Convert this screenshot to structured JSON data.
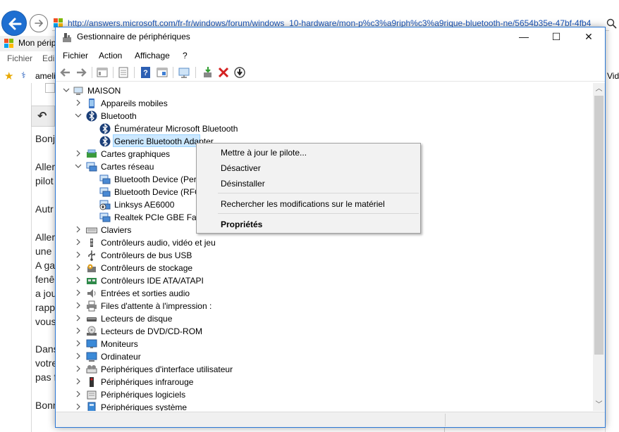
{
  "browser": {
    "url": "http://answers.microsoft.com/fr-fr/windows/forum/windows_10-hardware/mon-p%c3%a9riph%c3%a9rique-bluetooth-ne/5654b35e-47bf-4fb4",
    "tab_title": "Mon périp",
    "menu": [
      "Fichier",
      "Edi"
    ],
    "fav_item": "ameli",
    "fav_right": "Vid",
    "content_lines": [
      "Bonj",
      "Aller",
      "pilot",
      "Autr",
      "Aller",
      "une",
      "A ga",
      "fenê",
      "a jou",
      "rapp",
      "vous",
      "Dans",
      "votre",
      "pas f",
      "Bonn"
    ]
  },
  "window": {
    "title": "Gestionnaire de périphériques",
    "controls": {
      "minimize": "—",
      "maximize": "☐",
      "close": "✕"
    },
    "menu": [
      "Fichier",
      "Action",
      "Affichage",
      "?"
    ]
  },
  "tree": {
    "root": "MAISON",
    "items": [
      {
        "label": "Appareils mobiles",
        "icon": "mobile-device-icon",
        "level": 1,
        "expanded": false
      },
      {
        "label": "Bluetooth",
        "icon": "bluetooth-icon",
        "level": 1,
        "expanded": true
      },
      {
        "label": "Énumérateur Microsoft Bluetooth",
        "icon": "bluetooth-icon",
        "level": 2
      },
      {
        "label": "Generic Bluetooth Adapter",
        "icon": "bluetooth-icon",
        "level": 2,
        "selected": true
      },
      {
        "label": "Cartes graphiques",
        "icon": "display-adapter-icon",
        "level": 1,
        "expanded": false
      },
      {
        "label": "Cartes réseau",
        "icon": "network-adapter-icon",
        "level": 1,
        "expanded": true
      },
      {
        "label": "Bluetooth Device (Per",
        "icon": "network-adapter-icon",
        "level": 2
      },
      {
        "label": "Bluetooth Device (RFC",
        "icon": "network-adapter-icon",
        "level": 2
      },
      {
        "label": "Linksys AE6000",
        "icon": "network-adapter-warning-icon",
        "level": 2
      },
      {
        "label": "Realtek PCIe GBE Fam",
        "icon": "network-adapter-icon",
        "level": 2
      },
      {
        "label": "Claviers",
        "icon": "keyboard-icon",
        "level": 1,
        "expanded": false
      },
      {
        "label": "Contrôleurs audio, vidéo et jeu",
        "icon": "audio-icon",
        "level": 1,
        "expanded": false
      },
      {
        "label": "Contrôleurs de bus USB",
        "icon": "usb-icon",
        "level": 1,
        "expanded": false
      },
      {
        "label": "Contrôleurs de stockage",
        "icon": "storage-controller-icon",
        "level": 1,
        "expanded": false
      },
      {
        "label": "Contrôleurs IDE ATA/ATAPI",
        "icon": "ide-controller-icon",
        "level": 1,
        "expanded": false
      },
      {
        "label": "Entrées et sorties audio",
        "icon": "speaker-icon",
        "level": 1,
        "expanded": false
      },
      {
        "label": "Files d'attente à l'impression :",
        "icon": "printer-icon",
        "level": 1,
        "expanded": false
      },
      {
        "label": "Lecteurs de disque",
        "icon": "disk-drive-icon",
        "level": 1,
        "expanded": false
      },
      {
        "label": "Lecteurs de DVD/CD-ROM",
        "icon": "dvd-drive-icon",
        "level": 1,
        "expanded": false
      },
      {
        "label": "Moniteurs",
        "icon": "monitor-icon",
        "level": 1,
        "expanded": false
      },
      {
        "label": "Ordinateur",
        "icon": "computer-icon",
        "level": 1,
        "expanded": false
      },
      {
        "label": "Périphériques d'interface utilisateur",
        "icon": "hid-icon",
        "level": 1,
        "expanded": false
      },
      {
        "label": "Périphériques infrarouge",
        "icon": "infrared-icon",
        "level": 1,
        "expanded": false
      },
      {
        "label": "Périphériques logiciels",
        "icon": "software-device-icon",
        "level": 1,
        "expanded": false
      },
      {
        "label": "Périphériques système",
        "icon": "system-device-icon",
        "level": 1,
        "expanded": false
      }
    ]
  },
  "context_menu": {
    "items": [
      {
        "label": "Mettre à jour le pilote...",
        "bold": false
      },
      {
        "label": "Désactiver",
        "bold": false
      },
      {
        "label": "Désinstaller",
        "bold": false
      },
      {
        "label": "Rechercher les modifications sur le matériel",
        "bold": false
      },
      {
        "label": "Propriétés",
        "bold": true
      }
    ]
  },
  "colors": {
    "accent": "#2b78d6",
    "selection": "#cce8ff",
    "link": "#1a55b8",
    "delete_red": "#d42020"
  }
}
